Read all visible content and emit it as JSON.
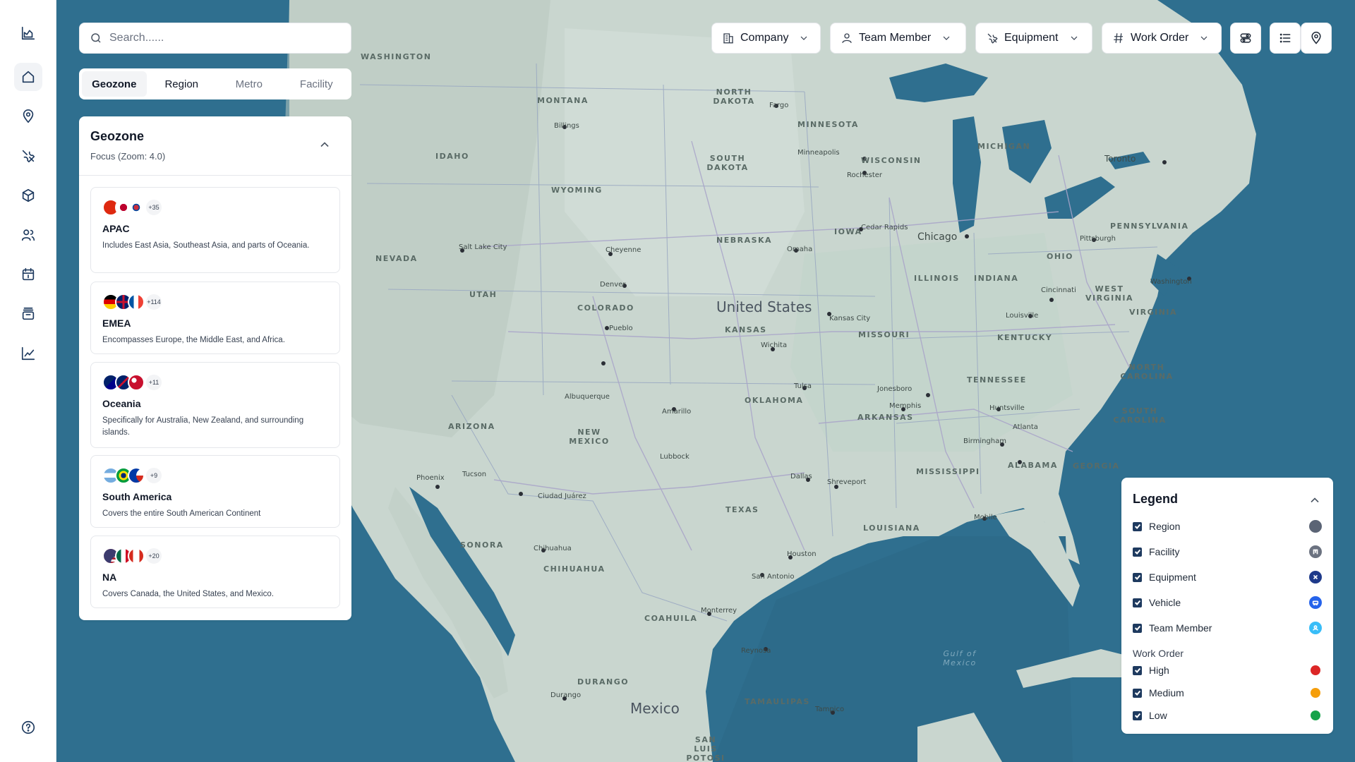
{
  "search": {
    "placeholder": "Search......"
  },
  "tabs": [
    {
      "label": "Geozone",
      "active": true
    },
    {
      "label": "Region",
      "active": false
    },
    {
      "label": "Metro",
      "active": false
    },
    {
      "label": "Facility",
      "active": false
    }
  ],
  "panel": {
    "title": "Geozone",
    "subtitle": "Focus (Zoom: 4.0)",
    "cards": [
      {
        "flags_more": "+35",
        "title": "APAC",
        "description": "Includes East Asia, Southeast Asia, and parts of Oceania."
      },
      {
        "flags_more": "+114",
        "title": "EMEA",
        "description": "Encompasses Europe, the Middle East, and Africa."
      },
      {
        "flags_more": "+11",
        "title": "Oceania",
        "description": "Specifically for Australia, New Zealand, and surrounding islands."
      },
      {
        "flags_more": "+9",
        "title": "South America",
        "description": "Covers the entire South American Continent"
      },
      {
        "flags_more": "+20",
        "title": "NA",
        "description": "Covers Canada, the United States, and Mexico."
      }
    ]
  },
  "filters": [
    {
      "label": "Company",
      "icon": "building-icon"
    },
    {
      "label": "Team Member",
      "icon": "user-icon"
    },
    {
      "label": "Equipment",
      "icon": "tools-icon"
    },
    {
      "label": "Work Order",
      "icon": "hash-icon"
    }
  ],
  "legend": {
    "title": "Legend",
    "items": [
      {
        "label": "Region",
        "color": "#5b6475"
      },
      {
        "label": "Facility",
        "color": "#6b7280"
      },
      {
        "label": "Equipment",
        "color": "#1e3a8a"
      },
      {
        "label": "Vehicle",
        "color": "#2563eb"
      },
      {
        "label": "Team Member",
        "color": "#38bdf8"
      }
    ],
    "group_label": "Work Order",
    "priorities": [
      {
        "label": "High",
        "color": "#dc2626"
      },
      {
        "label": "Medium",
        "color": "#f59e0b"
      },
      {
        "label": "Low",
        "color": "#16a34a"
      }
    ]
  },
  "map": {
    "country_labels": [
      "United States",
      "Mexico"
    ],
    "state_labels": [
      "WASHINGTON",
      "MONTANA",
      "NORTH DAKOTA",
      "MINNESOTA",
      "IDAHO",
      "SOUTH DAKOTA",
      "WISCONSIN",
      "MICHIGAN",
      "WYOMING",
      "NEBRASKA",
      "IOWA",
      "NEVADA",
      "UTAH",
      "COLORADO",
      "KANSAS",
      "MISSOURI",
      "ILLINOIS",
      "INDIANA",
      "OHIO",
      "PENNSYLVANIA",
      "WEST VIRGINIA",
      "VIRGINIA",
      "KENTUCKY",
      "TENNESSEE",
      "NORTH CAROLINA",
      "SOUTH CAROLINA",
      "OKLAHOMA",
      "ARKANSAS",
      "ARIZONA",
      "NEW MEXICO",
      "TEXAS",
      "MISSISSIPPI",
      "ALABAMA",
      "GEORGIA",
      "LOUISIANA",
      "SONORA",
      "CHIHUAHUA",
      "COAHUILA",
      "DURANGO",
      "TAMAULIPAS",
      "SAN LUIS POTOSI"
    ],
    "city_labels": [
      "Chicago",
      "Denver",
      "Wichita",
      "Dallas",
      "Houston",
      "San Antonio",
      "Phoenix",
      "Tucson",
      "Albuquerque",
      "Amarillo",
      "Lubbock",
      "Memphis",
      "Atlanta",
      "Birmingham",
      "Minneapolis",
      "Toronto",
      "Cincinnati",
      "Louisville",
      "Kansas City",
      "Omaha",
      "Cheyenne",
      "Pueblo",
      "Tulsa",
      "Shreveport",
      "Mobile",
      "Washington",
      "Pittsburgh",
      "Salt Lake City",
      "Billings",
      "Fargo",
      "Rochester",
      "Cedar Rapids",
      "Jonesboro",
      "Huntsville",
      "Monterrey",
      "Chihuahua",
      "Ciudad Juárez",
      "Reynosa",
      "Tampico",
      "Durango"
    ],
    "water_labels": [
      "Gulf of Mexico"
    ]
  }
}
